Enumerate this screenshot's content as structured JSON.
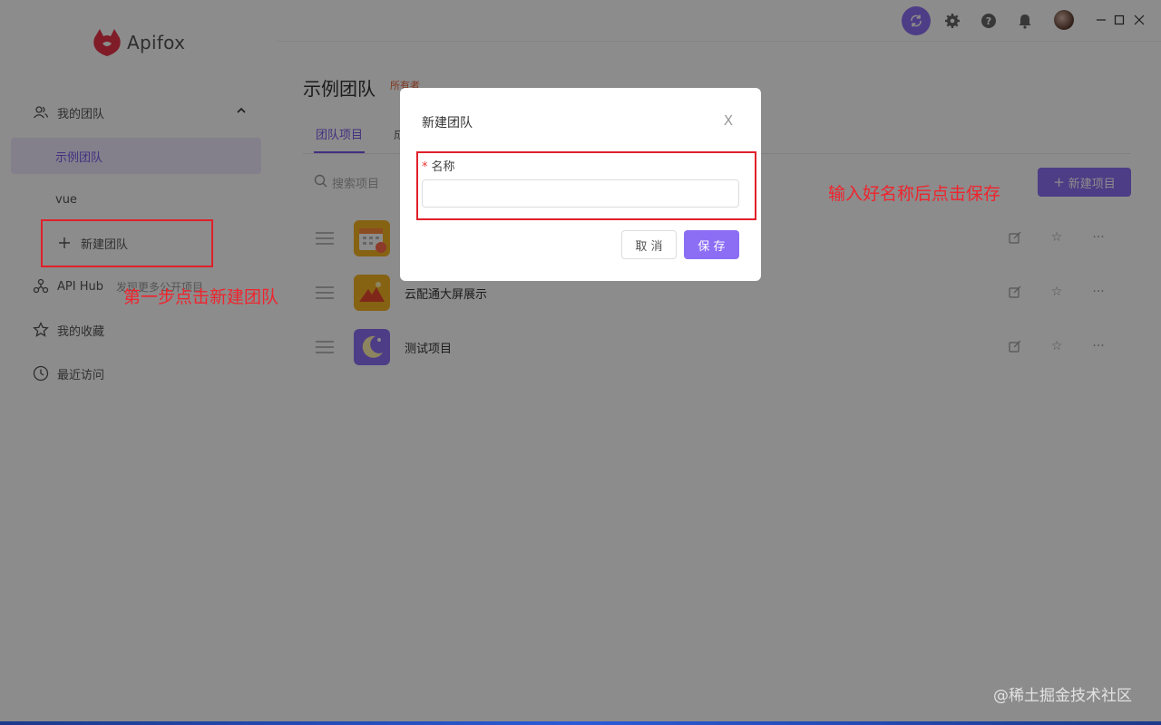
{
  "app": {
    "name": "Apifox"
  },
  "sidebar": {
    "my_team": "我的团队",
    "teams": [
      "示例团队",
      "vue"
    ],
    "new_team": "新建团队",
    "api_hub": "API Hub",
    "api_hub_extra": "发现更多公开项目",
    "favorites": "我的收藏",
    "recent": "最近访问"
  },
  "main": {
    "team_title": "示例团队",
    "owner_badge": "所有者",
    "tabs": [
      "团队项目",
      "成员"
    ],
    "search_placeholder": "搜索项目",
    "new_project": "新建项目",
    "projects": [
      {
        "name": "",
        "icon": "calendar-icon",
        "color": "#f5b324"
      },
      {
        "name": "云配通大屏展示",
        "icon": "mountain-icon",
        "color": "#f5b324"
      },
      {
        "name": "测试项目",
        "icon": "moon-icon",
        "color": "#8c6ef5"
      }
    ]
  },
  "dialog": {
    "title": "新建团队",
    "close": "X",
    "required_mark": "*",
    "field_label": "名称",
    "field_value": "",
    "cancel": "取 消",
    "save": "保 存"
  },
  "annotations": {
    "step1": "第一步点击新建团队",
    "step2": "输入好名称后点击保存"
  },
  "watermark": "@稀土掘金技术社区",
  "colors": {
    "accent": "#8c6ef5",
    "annotation": "#e0202a"
  }
}
